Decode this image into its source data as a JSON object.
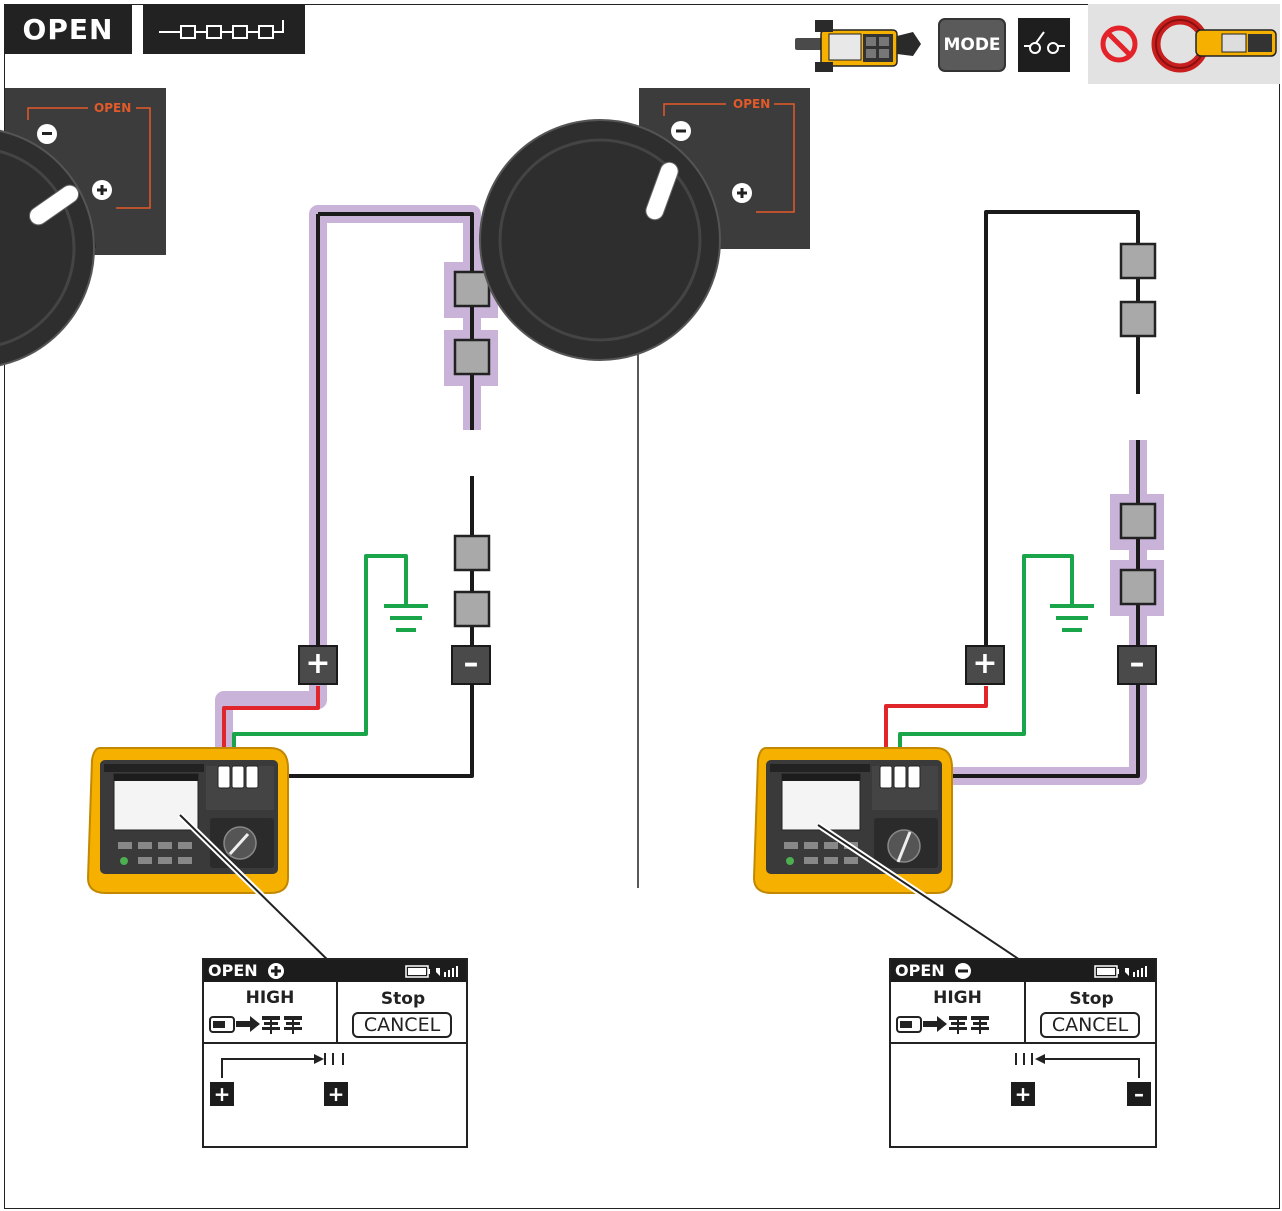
{
  "header": {
    "title": "OPEN",
    "mode_label": "MODE"
  },
  "panels": [
    {
      "id": "left",
      "dial": {
        "label": "OPEN",
        "minus": "–",
        "plus": "+"
      },
      "terminals": {
        "plus": "+",
        "minus": "–"
      },
      "display": {
        "title": "OPEN",
        "polarity": "plus",
        "high_label": "HIGH",
        "stop_label": "Stop",
        "cancel_label": "CANCEL",
        "term_left": "+",
        "term_right": "+"
      }
    },
    {
      "id": "right",
      "dial": {
        "label": "OPEN",
        "minus": "–",
        "plus": "+"
      },
      "terminals": {
        "plus": "+",
        "minus": "–"
      },
      "display": {
        "title": "OPEN",
        "polarity": "minus",
        "high_label": "HIGH",
        "stop_label": "Stop",
        "cancel_label": "CANCEL",
        "term_left": "+",
        "term_right": "–"
      }
    }
  ],
  "colors": {
    "highlight": "#c9b3d9",
    "wire_red": "#e0262b",
    "wire_green": "#1aa54a",
    "wire_black": "#1a1a1a",
    "module": "#a9a9a9",
    "meter_yellow": "#f5b000",
    "dial_orange": "#e35a2a",
    "prohibit_red": "#e3222a"
  },
  "icons": [
    "series-circuit-icon",
    "clamp-meter-icon",
    "mode-button-icon",
    "open-switch-icon",
    "no-symbol-icon",
    "clamp-meter-icon"
  ]
}
